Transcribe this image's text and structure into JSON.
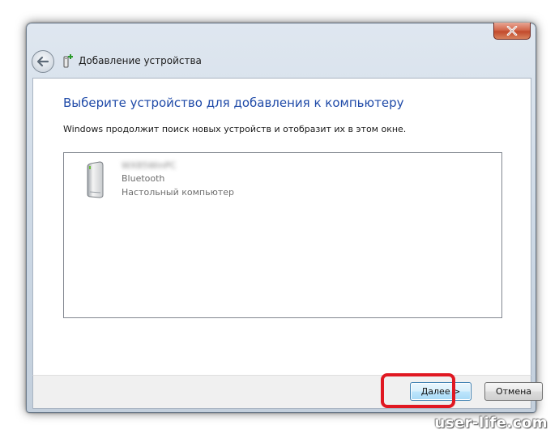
{
  "window": {
    "title": "Добавление устройства"
  },
  "main": {
    "heading": "Выберите устройство для добавления к компьютеру",
    "description": "Windows продолжит поиск новых устройств и отобразит их в этом окне."
  },
  "devices": [
    {
      "name": "WX85WinPC",
      "type": "Bluetooth",
      "category": "Настольный компьютер",
      "icon": "desktop-tower-icon"
    }
  ],
  "footer": {
    "next_label": "Далее >",
    "cancel_label": "Отмена"
  },
  "watermark": "user-life.com",
  "colors": {
    "heading": "#1f4aa8",
    "highlight": "#e01822",
    "close_button": "#c24a2c"
  }
}
